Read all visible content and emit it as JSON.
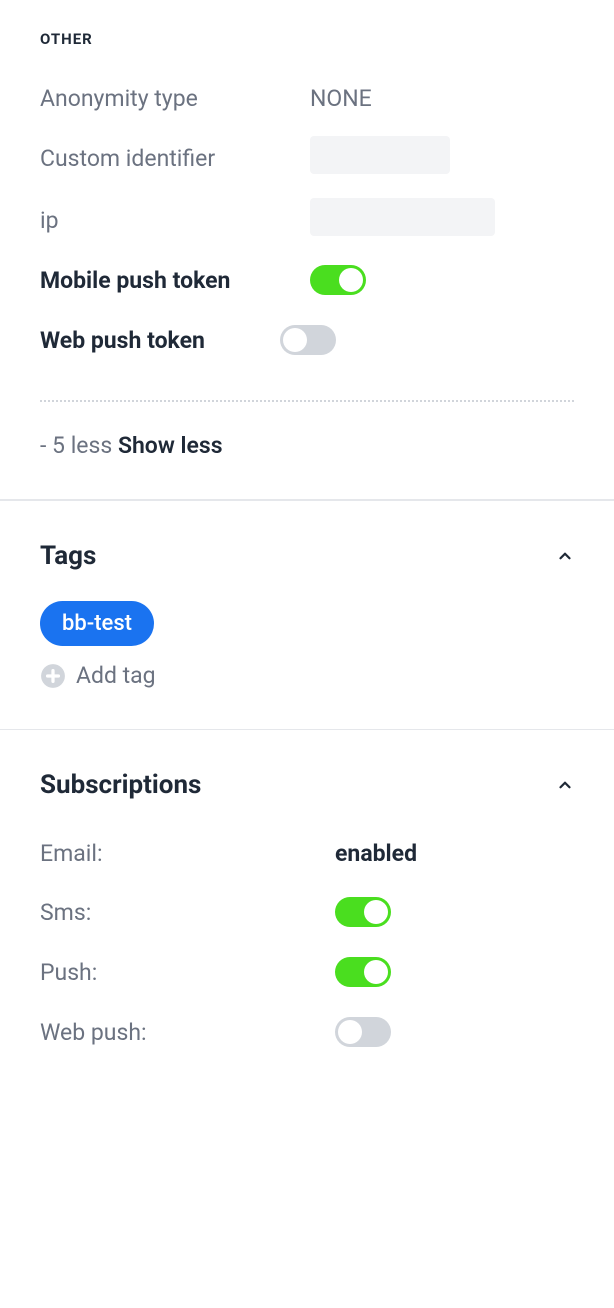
{
  "other": {
    "heading": "OTHER",
    "anonymity": {
      "label": "Anonymity type",
      "value": "NONE"
    },
    "custom_identifier": {
      "label": "Custom identifier"
    },
    "ip": {
      "label": "ip"
    },
    "mobile_push": {
      "label": "Mobile push token",
      "value": true
    },
    "web_push": {
      "label": "Web push token",
      "value": false
    },
    "showless_prefix": "- 5 less ",
    "showless_link": "Show less"
  },
  "tags": {
    "title": "Tags",
    "items": [
      "bb-test"
    ],
    "add_label": "Add tag"
  },
  "subscriptions": {
    "title": "Subscriptions",
    "email": {
      "label": "Email:",
      "value": "enabled"
    },
    "sms": {
      "label": "Sms:",
      "value": true
    },
    "push": {
      "label": "Push:",
      "value": true
    },
    "web_push": {
      "label": "Web push:",
      "value": false
    }
  }
}
